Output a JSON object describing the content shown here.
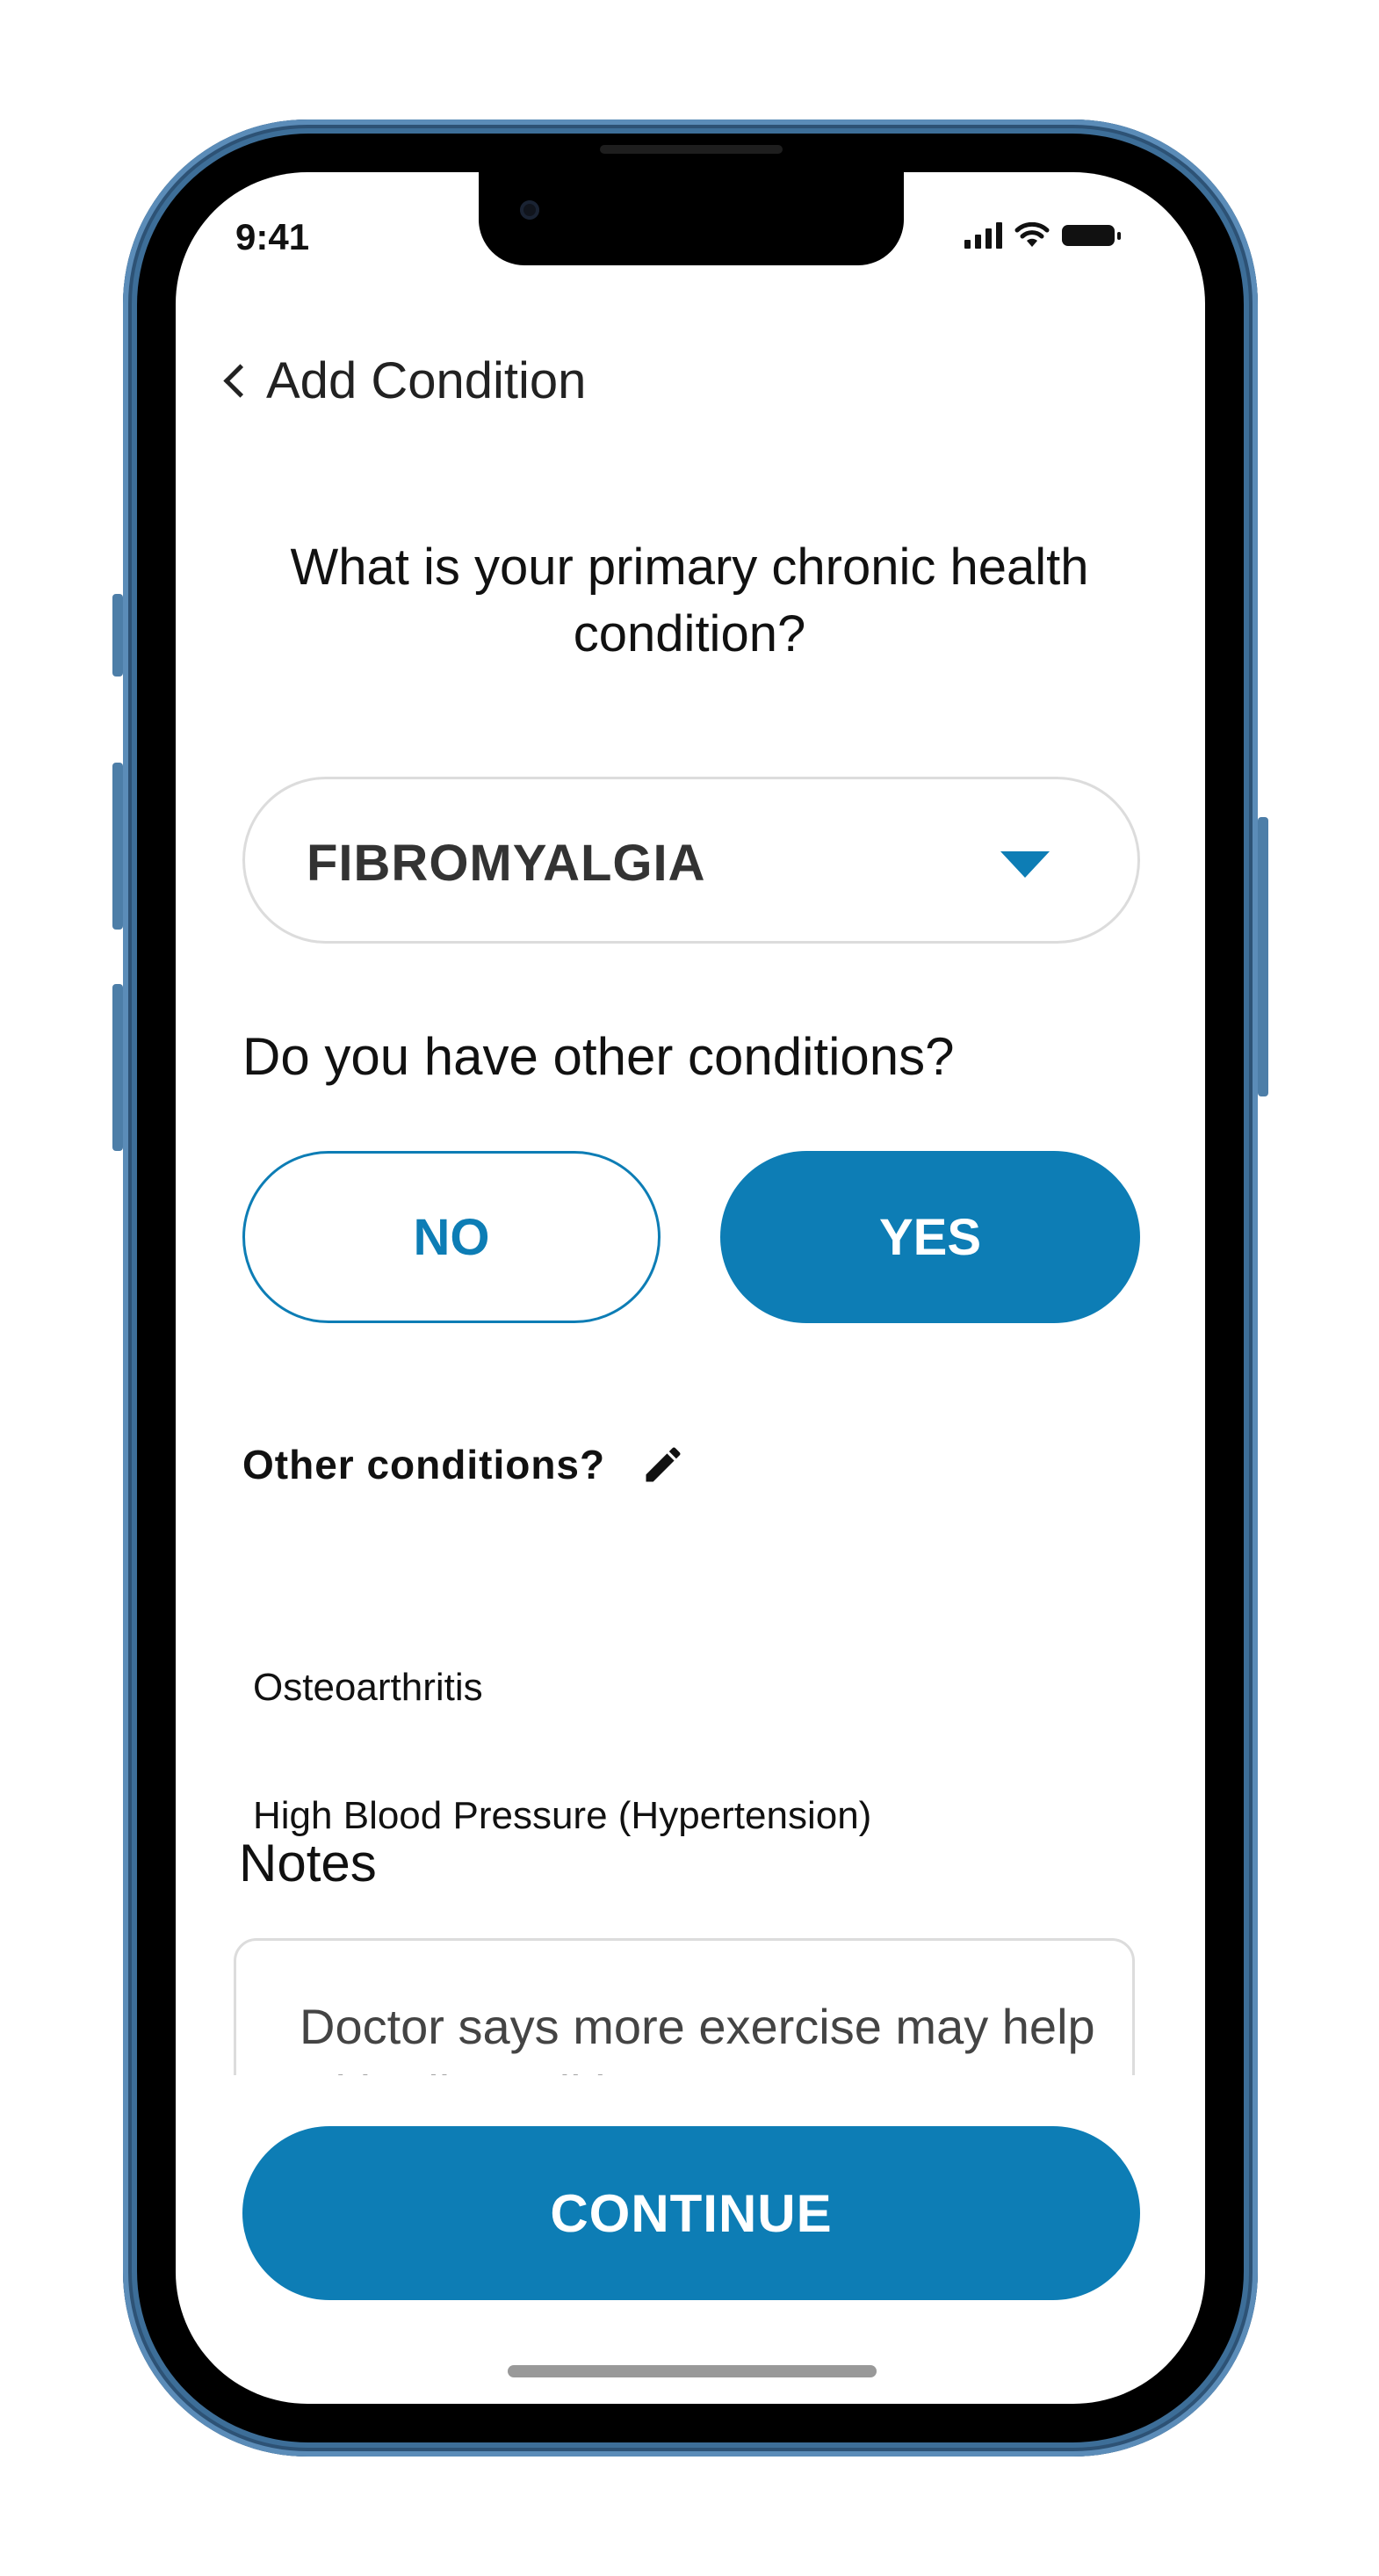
{
  "status_bar": {
    "time": "9:41",
    "icons": [
      "cellular-signal-icon",
      "wifi-icon",
      "battery-icon"
    ]
  },
  "nav": {
    "back_label": "Add Condition"
  },
  "primary": {
    "question": "What is your primary chronic health condition?",
    "selected_value": "FIBROMYALGIA"
  },
  "other": {
    "question": "Do you have other conditions?",
    "no_label": "NO",
    "yes_label": "YES",
    "selected": "YES",
    "list_heading": "Other conditions?",
    "items": [
      "Osteoarthritis",
      "High Blood Pressure (Hypertension)"
    ]
  },
  "notes": {
    "label": "Notes",
    "value": "Doctor says more exercise may help with all conditions"
  },
  "continue_label": "CONTINUE",
  "colors": {
    "accent": "#0d7db5",
    "phone_frame": "#3d6e98"
  }
}
